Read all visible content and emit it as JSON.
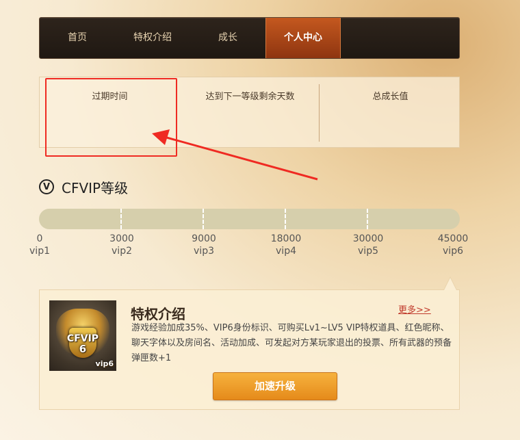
{
  "nav": {
    "items": [
      {
        "label": "首页"
      },
      {
        "label": "特权介绍"
      },
      {
        "label": "成长"
      },
      {
        "label": "个人中心"
      }
    ],
    "active": "个人中心"
  },
  "info": {
    "expire_label": "过期时间",
    "days_label": "达到下一等级剩余天数",
    "growth_label": "总成长值"
  },
  "section": {
    "icon": "v-circle-icon",
    "icon_glyph": "V",
    "title": "CFVIP等级"
  },
  "levels": [
    {
      "points": "0",
      "name": "vip1"
    },
    {
      "points": "3000",
      "name": "vip2"
    },
    {
      "points": "9000",
      "name": "vip3"
    },
    {
      "points": "18000",
      "name": "vip4"
    },
    {
      "points": "30000",
      "name": "vip5"
    },
    {
      "points": "45000",
      "name": "vip6"
    }
  ],
  "card": {
    "badge_text": "CFVIP",
    "badge_number": "6",
    "badge_level": "vip6",
    "title": "特权介绍",
    "more_label": "更多>>",
    "description": "游戏经验加成35%、VIP6身份标识、可购买Lv1~LV5 VIP特权道具、红色昵称、聊天字体以及房间名、活动加成、可发起对方某玩家退出的投票、所有武器的预备弹匣数+1",
    "button_label": "加速升级"
  },
  "colors": {
    "accent": "#c4581f",
    "annotation": "#ef2a22",
    "button": "#f0a030"
  }
}
